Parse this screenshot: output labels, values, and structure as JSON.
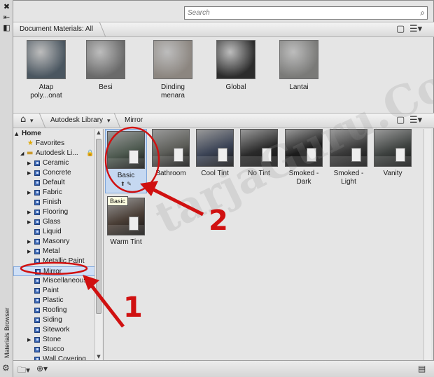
{
  "palette": {
    "title": "Materials Browser",
    "close_glyph": "✖",
    "autohide_glyph": "⇤",
    "properties_glyph": "◧"
  },
  "search": {
    "placeholder": "Search"
  },
  "document_bar": {
    "label": "Document Materials: All"
  },
  "document_materials": [
    {
      "name": "Atap poly...onat",
      "line1": "Atap",
      "line2": "poly...onat",
      "color": "#4a5660"
    },
    {
      "name": "Besi",
      "line1": "Besi",
      "line2": "",
      "color": "#6a6a6a"
    },
    {
      "name": "Dinding menara",
      "line1": "Dinding",
      "line2": "menara",
      "color": "#8c8680"
    },
    {
      "name": "Global",
      "line1": "Global",
      "line2": "",
      "color": "#2c2c2c"
    },
    {
      "name": "Lantai",
      "line1": "Lantai",
      "line2": "",
      "color": "#7a7a78"
    }
  ],
  "library_bar": {
    "home_glyph": "⌂",
    "library_label": "Autodesk Library",
    "current_label": "Mirror"
  },
  "tree": [
    {
      "label": "Home",
      "level": 0,
      "arrow": "▲",
      "icon": "none",
      "bold": true
    },
    {
      "label": "Favorites",
      "level": 1,
      "arrow": "",
      "icon": "star"
    },
    {
      "label": "Autodesk Li...",
      "level": 1,
      "arrow": "◢",
      "icon": "folder",
      "lock": true
    },
    {
      "label": "Ceramic",
      "level": 2,
      "arrow": "▶",
      "icon": "cube"
    },
    {
      "label": "Concrete",
      "level": 2,
      "arrow": "▶",
      "icon": "cube"
    },
    {
      "label": "Default",
      "level": 2,
      "arrow": "",
      "icon": "cube"
    },
    {
      "label": "Fabric",
      "level": 2,
      "arrow": "▶",
      "icon": "cube"
    },
    {
      "label": "Finish",
      "level": 2,
      "arrow": "",
      "icon": "cube"
    },
    {
      "label": "Flooring",
      "level": 2,
      "arrow": "▶",
      "icon": "cube"
    },
    {
      "label": "Glass",
      "level": 2,
      "arrow": "▶",
      "icon": "cube"
    },
    {
      "label": "Liquid",
      "level": 2,
      "arrow": "",
      "icon": "cube"
    },
    {
      "label": "Masonry",
      "level": 2,
      "arrow": "▶",
      "icon": "cube"
    },
    {
      "label": "Metal",
      "level": 2,
      "arrow": "▶",
      "icon": "cube"
    },
    {
      "label": "Metallic Paint",
      "level": 2,
      "arrow": "",
      "icon": "cube"
    },
    {
      "label": "Mirror",
      "level": 2,
      "arrow": "",
      "icon": "cube",
      "selected": true
    },
    {
      "label": "Miscellaneous",
      "level": 2,
      "arrow": "",
      "icon": "cube"
    },
    {
      "label": "Paint",
      "level": 2,
      "arrow": "",
      "icon": "cube"
    },
    {
      "label": "Plastic",
      "level": 2,
      "arrow": "",
      "icon": "cube"
    },
    {
      "label": "Roofing",
      "level": 2,
      "arrow": "",
      "icon": "cube"
    },
    {
      "label": "Siding",
      "level": 2,
      "arrow": "",
      "icon": "cube"
    },
    {
      "label": "Sitework",
      "level": 2,
      "arrow": "",
      "icon": "cube"
    },
    {
      "label": "Stone",
      "level": 2,
      "arrow": "▶",
      "icon": "cube"
    },
    {
      "label": "Stucco",
      "level": 2,
      "arrow": "",
      "icon": "cube"
    },
    {
      "label": "Wall Covering",
      "level": 2,
      "arrow": "",
      "icon": "cube"
    }
  ],
  "materials": [
    {
      "line1": "Basic",
      "line2": "",
      "color": "#4e5a50",
      "selected": true
    },
    {
      "line1": "Bathroom",
      "line2": "",
      "color": "#5c5d58"
    },
    {
      "line1": "Cool Tint",
      "line2": "",
      "color": "#3c4456"
    },
    {
      "line1": "No Tint",
      "line2": "",
      "color": "#2a2a2a"
    },
    {
      "line1": "Smoked -",
      "line2": "Dark",
      "color": "#1c1c1c"
    },
    {
      "line1": "Smoked -",
      "line2": "Light",
      "color": "#3a3a3a"
    },
    {
      "line1": "Vanity",
      "line2": "",
      "color": "#3e4240"
    },
    {
      "line1": "Warm Tint",
      "line2": "",
      "color": "#4a3e36"
    }
  ],
  "tooltip": "Basic",
  "annotations": {
    "step1": "1",
    "step2": "2",
    "accent": "#d01010"
  },
  "watermark": "tarjaGuru.Com"
}
